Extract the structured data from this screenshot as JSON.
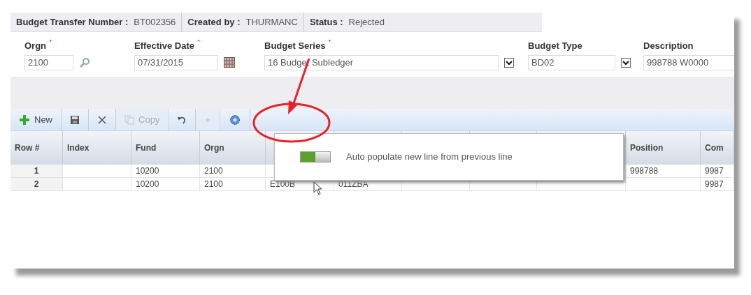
{
  "header": [
    {
      "label": "Budget Transfer Number :",
      "value": "BT002356"
    },
    {
      "label": "Created by :",
      "value": "THURMANC"
    },
    {
      "label": "Status :",
      "value": "Rejected"
    }
  ],
  "form": [
    {
      "kind": "lookup",
      "label": "Orgn",
      "required": true,
      "value": "2100"
    },
    {
      "kind": "date",
      "label": "Effective Date",
      "required": true,
      "value": "07/31/2015"
    },
    {
      "kind": "select",
      "label": "Budget Series",
      "required": true,
      "value": "16 Budget Subledger"
    },
    {
      "kind": "select",
      "label": "Budget Type",
      "value": "BD02"
    },
    {
      "kind": "text",
      "label": "Description",
      "value": "998788 W0000"
    }
  ],
  "toolbar": [
    {
      "kind": "new",
      "label": "New",
      "disabled": false
    },
    {
      "kind": "save",
      "disabled": false
    },
    {
      "kind": "delete",
      "disabled": false
    },
    {
      "kind": "copy",
      "label": "Copy",
      "disabled": true
    },
    {
      "kind": "undo",
      "disabled": false
    },
    {
      "kind": "extra",
      "disabled": true
    },
    {
      "kind": "settings",
      "disabled": false
    }
  ],
  "table": {
    "columns": [
      {
        "label": "Row #"
      },
      {
        "label": "Index"
      },
      {
        "label": "Fund"
      },
      {
        "label": "Orgn"
      },
      {},
      {},
      {},
      {},
      {},
      {
        "label": "Position"
      },
      {
        "label": "Com"
      }
    ],
    "rows": [
      {
        "cells": [
          "1",
          null,
          "10200",
          "2100",
          null,
          null,
          null,
          null,
          null,
          "998788",
          "9987"
        ]
      },
      {
        "cells": [
          "2",
          null,
          "10200",
          "2100",
          "E100B",
          "011ZBA",
          null,
          null,
          null,
          null,
          "9987"
        ]
      }
    ]
  },
  "popup": {
    "on": true,
    "label": "Auto populate new line from previous line"
  }
}
